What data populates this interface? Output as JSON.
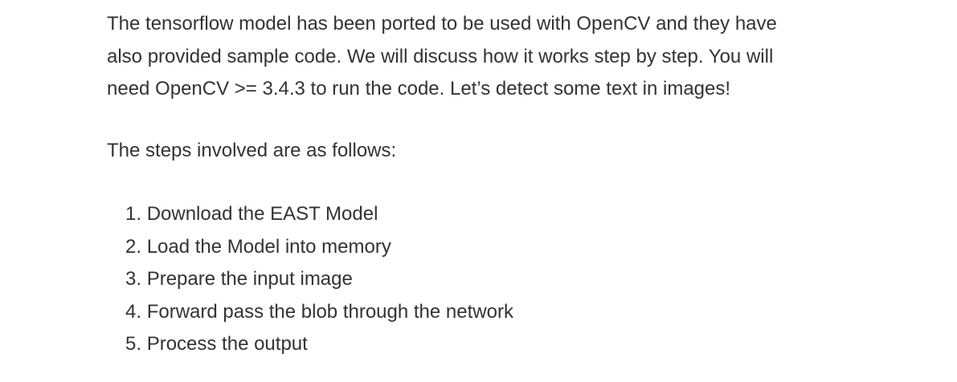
{
  "article": {
    "intro": "The tensorflow model has been ported to be used with OpenCV and they have also provided sample code. We will discuss how it works step by step. You will need OpenCV >= 3.4.3 to run the code. Let’s detect some text in images!",
    "steps_heading": "The steps involved are as follows:",
    "steps": [
      {
        "number": "1.",
        "text": "Download the EAST Model"
      },
      {
        "number": "2.",
        "text": "Load the Model into memory"
      },
      {
        "number": "3.",
        "text": "Prepare the input image"
      },
      {
        "number": "4.",
        "text": "Forward pass the blob through the network"
      },
      {
        "number": "5.",
        "text": "Process the output"
      }
    ]
  }
}
